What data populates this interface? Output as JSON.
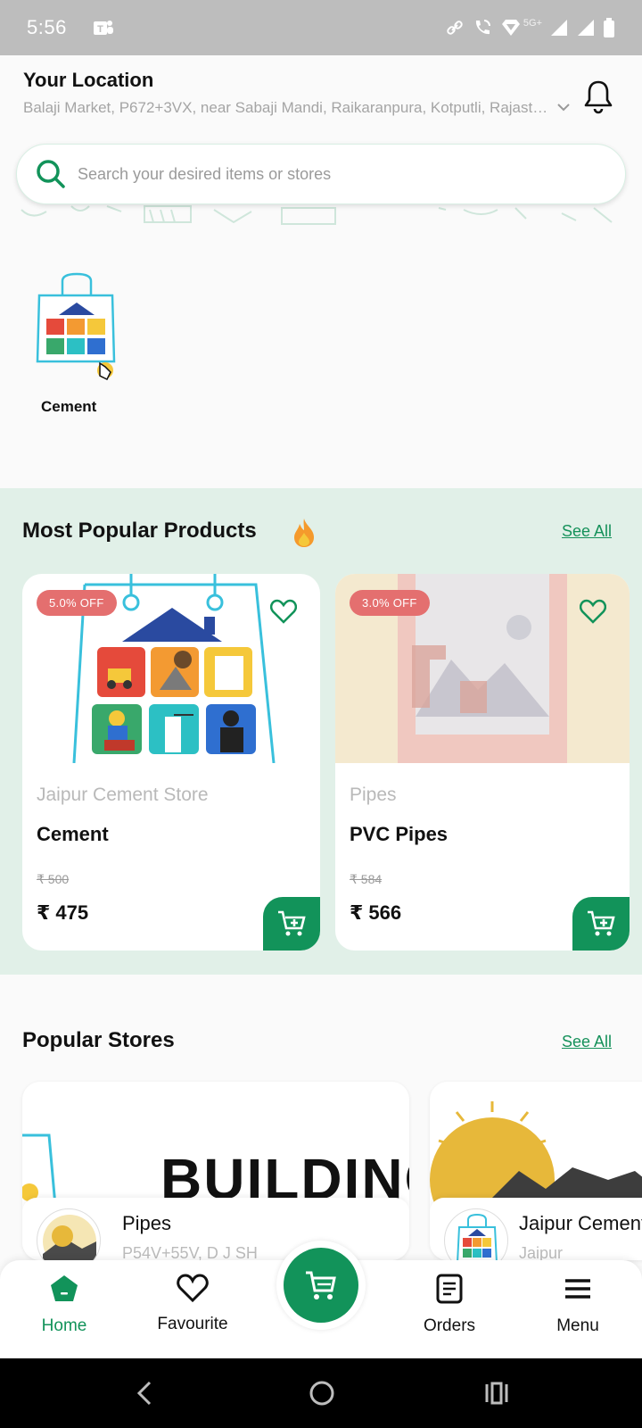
{
  "status_bar": {
    "time": "5:56",
    "network": "5G+"
  },
  "header": {
    "title": "Your Location",
    "address": "Balaji Market, P672+3VX, near Sabaji Mandi, Raikaranpura, Kotputli, Rajasthan"
  },
  "search": {
    "placeholder": "Search your desired items or stores"
  },
  "categories": [
    {
      "label": "Cement"
    }
  ],
  "popular_products": {
    "title": "Most Popular Products",
    "see_all": "See All",
    "items": [
      {
        "discount": "5.0% OFF",
        "store": "Jaipur Cement Store",
        "name": "Cement",
        "old_price": "₹ 500",
        "price": "₹ 475"
      },
      {
        "discount": "3.0% OFF",
        "store": "Pipes",
        "name": "PVC Pipes",
        "old_price": "₹ 584",
        "price": "₹ 566"
      }
    ]
  },
  "popular_stores": {
    "title": "Popular Stores",
    "see_all": "See All",
    "items": [
      {
        "banner": "BUILDING",
        "name": "Pipes",
        "address": "P54V+55V, D J SH"
      },
      {
        "name": "Jaipur Cement Store",
        "address": "Jaipur"
      }
    ]
  },
  "bottom_nav": {
    "home": "Home",
    "favourite": "Favourite",
    "orders": "Orders",
    "menu": "Menu"
  },
  "colors": {
    "primary": "#12935a",
    "discount": "#e46f6f",
    "section_bg": "#e1f0e8"
  }
}
